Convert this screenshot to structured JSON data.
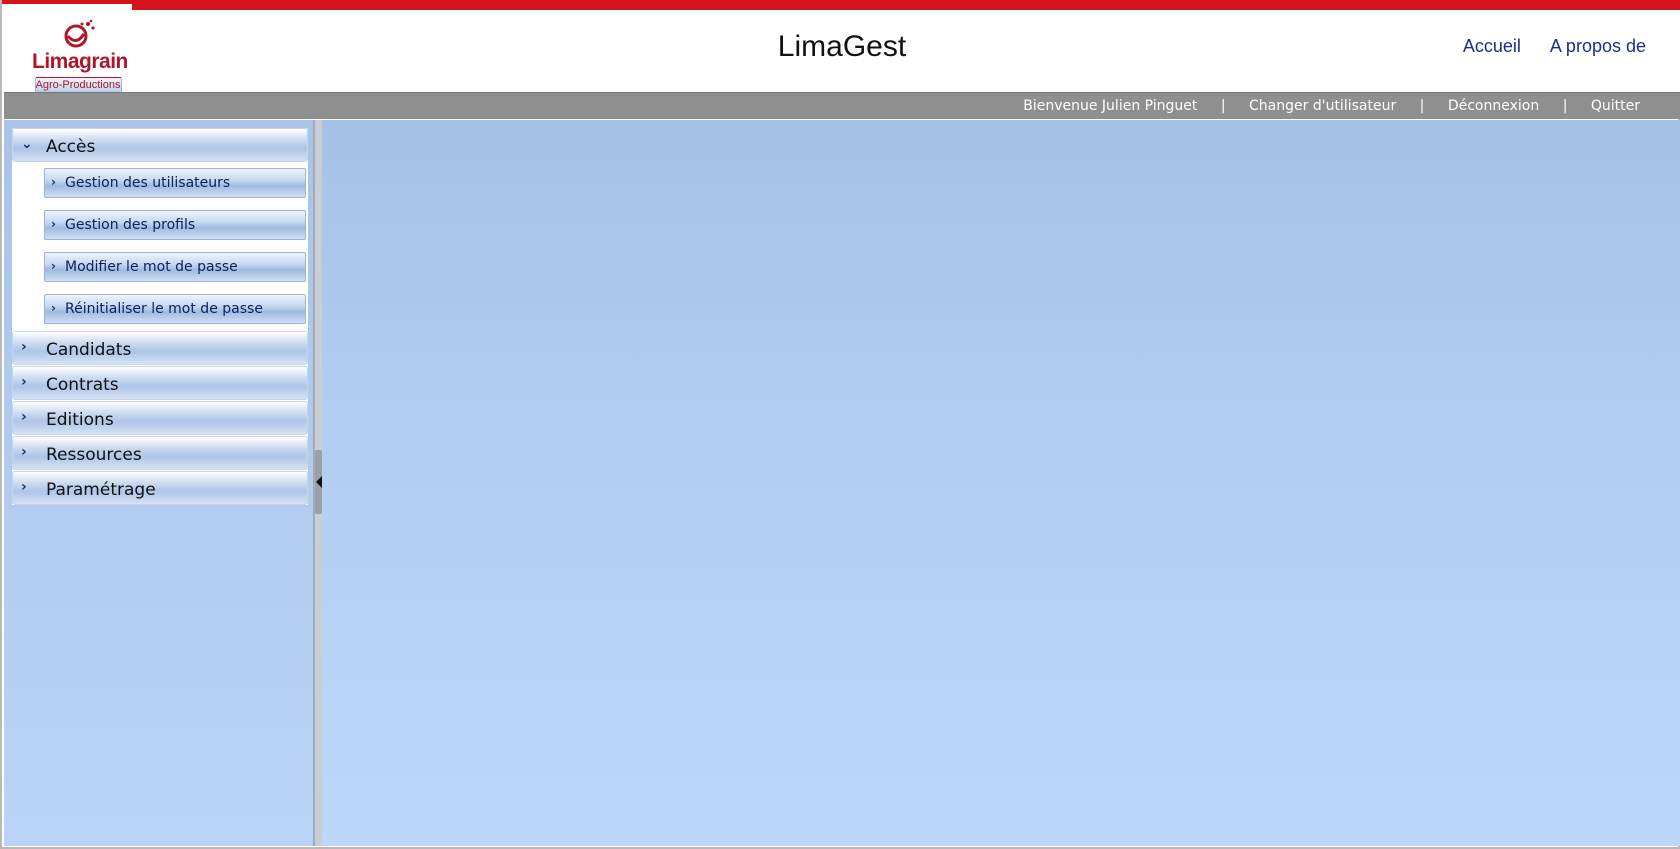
{
  "app": {
    "title": "LimaGest"
  },
  "logo": {
    "brand": "Limagrain",
    "sub": "Agro-Productions"
  },
  "top_links": [
    {
      "label": "Accueil"
    },
    {
      "label": "A propos de"
    }
  ],
  "userbar": {
    "welcome": "Bienvenue Julien Pinguet",
    "separator": "|",
    "change_user": "Changer d'utilisateur",
    "logout": "Déconnexion",
    "quit": "Quitter"
  },
  "menu": {
    "groups": [
      {
        "label": "Accès",
        "expanded": true,
        "items": [
          {
            "label": "Gestion des utilisateurs"
          },
          {
            "label": "Gestion des profils"
          },
          {
            "label": "Modifier le mot de passe"
          },
          {
            "label": "Réinitialiser le mot de passe"
          }
        ]
      },
      {
        "label": "Candidats",
        "expanded": false
      },
      {
        "label": "Contrats",
        "expanded": false
      },
      {
        "label": "Editions",
        "expanded": false
      },
      {
        "label": "Ressources",
        "expanded": false
      },
      {
        "label": "Paramétrage",
        "expanded": false
      }
    ]
  },
  "colors": {
    "brand_red": "#d6121d",
    "logo_red": "#b0162a",
    "link_blue": "#1a2f8a",
    "userbar_grey": "#8f8f8f",
    "content_blue": "#b2cdf1"
  }
}
